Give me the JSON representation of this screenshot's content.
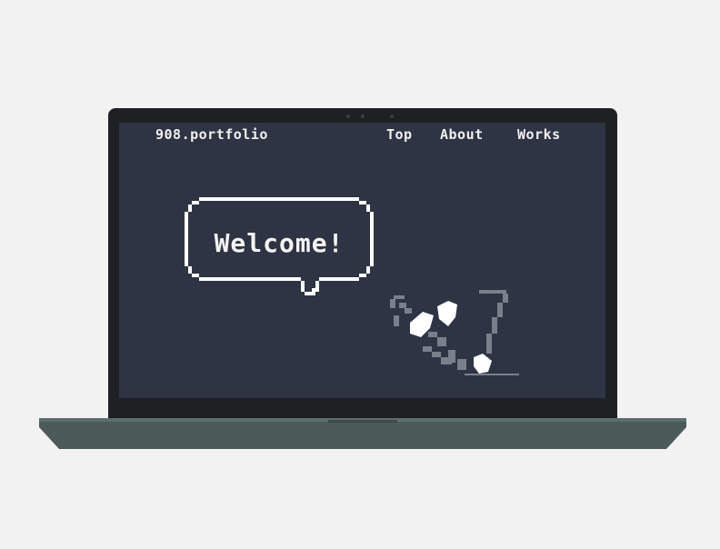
{
  "nav": {
    "brand": "908.portfolio",
    "links": [
      "Top",
      "About",
      "Works"
    ]
  },
  "hero": {
    "bubble_text": "Welcome!"
  },
  "colors": {
    "screen_bg": "#2f3444",
    "text": "#f0f0f0",
    "lid": "#1f2024",
    "base": "#4c5a59"
  }
}
